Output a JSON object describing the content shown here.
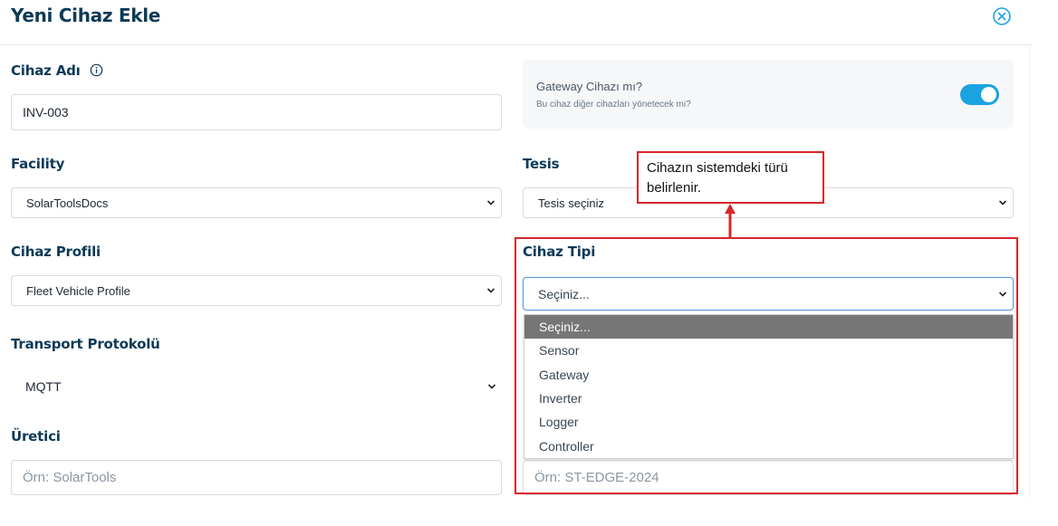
{
  "modal": {
    "title": "Yeni Cihaz Ekle"
  },
  "fields": {
    "device_name": {
      "label": "Cihaz Adı",
      "value": "INV-003"
    },
    "facility": {
      "label": "Facility",
      "selected": "SolarToolsDocs"
    },
    "tesis": {
      "label": "Tesis",
      "selected": "Tesis seçiniz"
    },
    "device_profile": {
      "label": "Cihaz Profili",
      "selected": "Fleet Vehicle Profile"
    },
    "device_type": {
      "label": "Cihaz Tipi",
      "selected": "Seçiniz..."
    },
    "transport": {
      "label": "Transport Protokolü",
      "selected": "MQTT"
    },
    "manufacturer": {
      "label": "Üretici",
      "placeholder": "Örn: SolarTools"
    },
    "model": {
      "placeholder": "Örn: ST-EDGE-2024"
    }
  },
  "gateway": {
    "question": "Gateway Cihazı mı?",
    "description": "Bu cihaz diğer cihazları yönetecek mi?",
    "enabled": true
  },
  "device_type_options": [
    "Seçiniz...",
    "Sensor",
    "Gateway",
    "Inverter",
    "Logger",
    "Controller"
  ],
  "annotation": {
    "text": "Cihazın sistemdeki türü belirlenir.",
    "color": "#d8262b"
  },
  "colors": {
    "heading": "#0c3a57",
    "accent": "#1aa3e0",
    "close": "#1aa3e0",
    "selected_option_bg": "#767676"
  }
}
